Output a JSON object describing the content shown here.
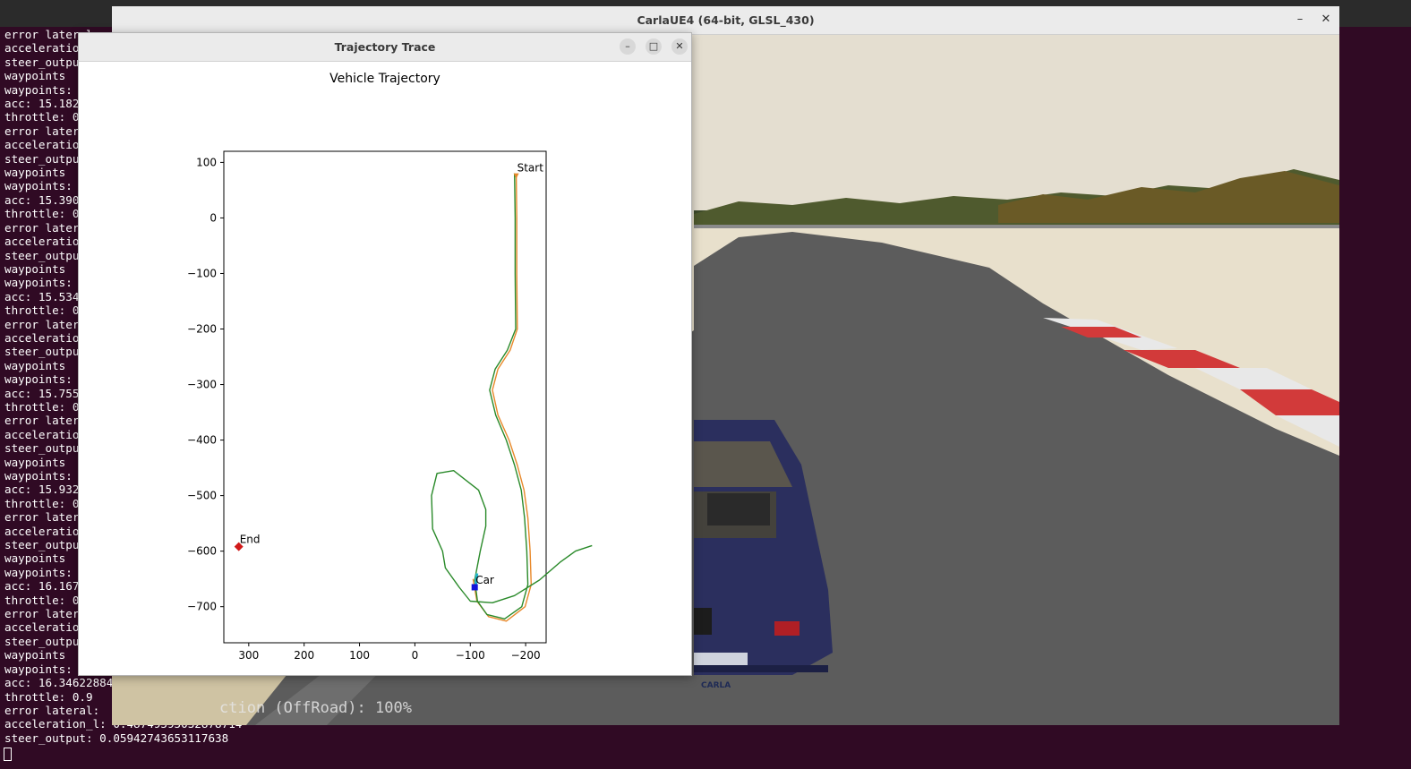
{
  "terminal": {
    "lines": [
      "error lateral: ",
      "acceleration_l",
      "steer_output: ",
      "waypoints ",
      "waypoints: ",
      "acc: 15.182",
      "throttle: 0",
      "error lateral: ",
      "acceleration_l",
      "steer_output: ",
      "waypoints ",
      "waypoints: ",
      "acc: 15.390",
      "throttle: 0",
      "error lateral: ",
      "acceleration_l",
      "steer_output: ",
      "waypoints ",
      "waypoints: ",
      "acc: 15.534",
      "throttle: 0",
      "error lateral: ",
      "acceleration_l",
      "steer_output: ",
      "waypoints ",
      "waypoints: ",
      "acc: 15.755",
      "throttle: 0",
      "error lateral: ",
      "acceleration_l",
      "steer_output: ",
      "waypoints ",
      "waypoints: ",
      "acc: 15.932",
      "throttle: 0",
      "error lateral: ",
      "acceleration_l",
      "steer_output: ",
      "waypoints ",
      "waypoints: ",
      "acc: 16.167",
      "throttle: 0",
      "error lateral: ",
      "acceleration_l",
      "steer_output: ",
      "waypoints ",
      "waypoints: ",
      "acc: 16.34622884",
      "throttle: 0.9",
      "error lateral: ",
      "acceleration_l: 0.48749595032878714",
      "steer_output: 0.05942743653117638"
    ]
  },
  "carla_window": {
    "title": "CarlaUE4 (64-bit, GLSL_430)",
    "minimize_glyph": "–",
    "close_glyph": "✕",
    "hud_text": "ction (OffRoad): 100%",
    "plate_text": "CARLA",
    "colors": {
      "sky": "#e4ded0",
      "asphalt": "#5c5c5c",
      "car": "#2b2f5e",
      "kerb_red": "#d23a3a"
    }
  },
  "trajectory_window": {
    "title": "Trajectory Trace",
    "minimize_glyph": "–",
    "maximize_glyph": "□",
    "close_glyph": "✕"
  },
  "chart_data": {
    "type": "line",
    "title": "Vehicle Trajectory",
    "xlabel": "",
    "ylabel": "",
    "xlim": [
      345,
      -237
    ],
    "ylim": [
      -765,
      120
    ],
    "xticks": [
      300,
      200,
      100,
      0,
      -100,
      -200
    ],
    "yticks": [
      100,
      0,
      -100,
      -200,
      -300,
      -400,
      -500,
      -600,
      -700
    ],
    "tick_labels_x": [
      "300",
      "200",
      "100",
      "0",
      "−100",
      "−200"
    ],
    "tick_labels_y": [
      "100",
      "0",
      "−100",
      "−200",
      "−300",
      "−400",
      "−500",
      "−600",
      "−700"
    ],
    "grid": false,
    "series": [
      {
        "name": "",
        "color": "#e8892b",
        "points": [
          [
            -183,
            77
          ],
          [
            -184,
            0
          ],
          [
            -184,
            -100
          ],
          [
            -185,
            -200
          ],
          [
            -172,
            -238
          ],
          [
            -150,
            -272
          ],
          [
            -140,
            -310
          ],
          [
            -150,
            -355
          ],
          [
            -170,
            -400
          ],
          [
            -185,
            -445
          ],
          [
            -197,
            -490
          ],
          [
            -204,
            -540
          ],
          [
            -208,
            -600
          ],
          [
            -210,
            -660
          ],
          [
            -199,
            -700
          ],
          [
            -165,
            -726
          ],
          [
            -133,
            -718
          ],
          [
            -112,
            -690
          ],
          [
            -105,
            -650
          ]
        ]
      },
      {
        "name": "",
        "color": "#2a8a2a",
        "points": [
          [
            -180,
            80
          ],
          [
            -181,
            0
          ],
          [
            -181,
            -100
          ],
          [
            -182,
            -200
          ],
          [
            -167,
            -238
          ],
          [
            -145,
            -272
          ],
          [
            -135,
            -310
          ],
          [
            -146,
            -355
          ],
          [
            -165,
            -400
          ],
          [
            -180,
            -445
          ],
          [
            -192,
            -490
          ],
          [
            -198,
            -540
          ],
          [
            -202,
            -600
          ],
          [
            -204,
            -660
          ],
          [
            -193,
            -700
          ],
          [
            -162,
            -722
          ],
          [
            -130,
            -714
          ],
          [
            -113,
            -690
          ],
          [
            -108,
            -652
          ],
          [
            -118,
            -600
          ],
          [
            -128,
            -555
          ],
          [
            -128,
            -525
          ],
          [
            -115,
            -490
          ],
          [
            -70,
            -455
          ],
          [
            -40,
            -460
          ],
          [
            -30,
            -500
          ],
          [
            -32,
            -560
          ],
          [
            -50,
            -600
          ],
          [
            -55,
            -630
          ],
          [
            -80,
            -665
          ],
          [
            -100,
            -690
          ],
          [
            -140,
            -693
          ],
          [
            -180,
            -680
          ],
          [
            -225,
            -652
          ],
          [
            -262,
            -620
          ],
          [
            -290,
            -600
          ],
          [
            -320,
            -590
          ]
        ]
      },
      {
        "name": "",
        "color": "#1fb5c8",
        "points": [
          [
            -112,
            -640
          ],
          [
            -110,
            -660
          ]
        ]
      }
    ],
    "markers": [
      {
        "label": "Start",
        "x": -183,
        "y": 77,
        "shape": "triangle",
        "color": "#e8892b"
      },
      {
        "label": "End",
        "x": 318,
        "y": -592,
        "shape": "diamond",
        "color": "#d11a1a"
      },
      {
        "label": "Car",
        "x": -108,
        "y": -665,
        "shape": "square",
        "color": "#1414d8"
      }
    ]
  }
}
